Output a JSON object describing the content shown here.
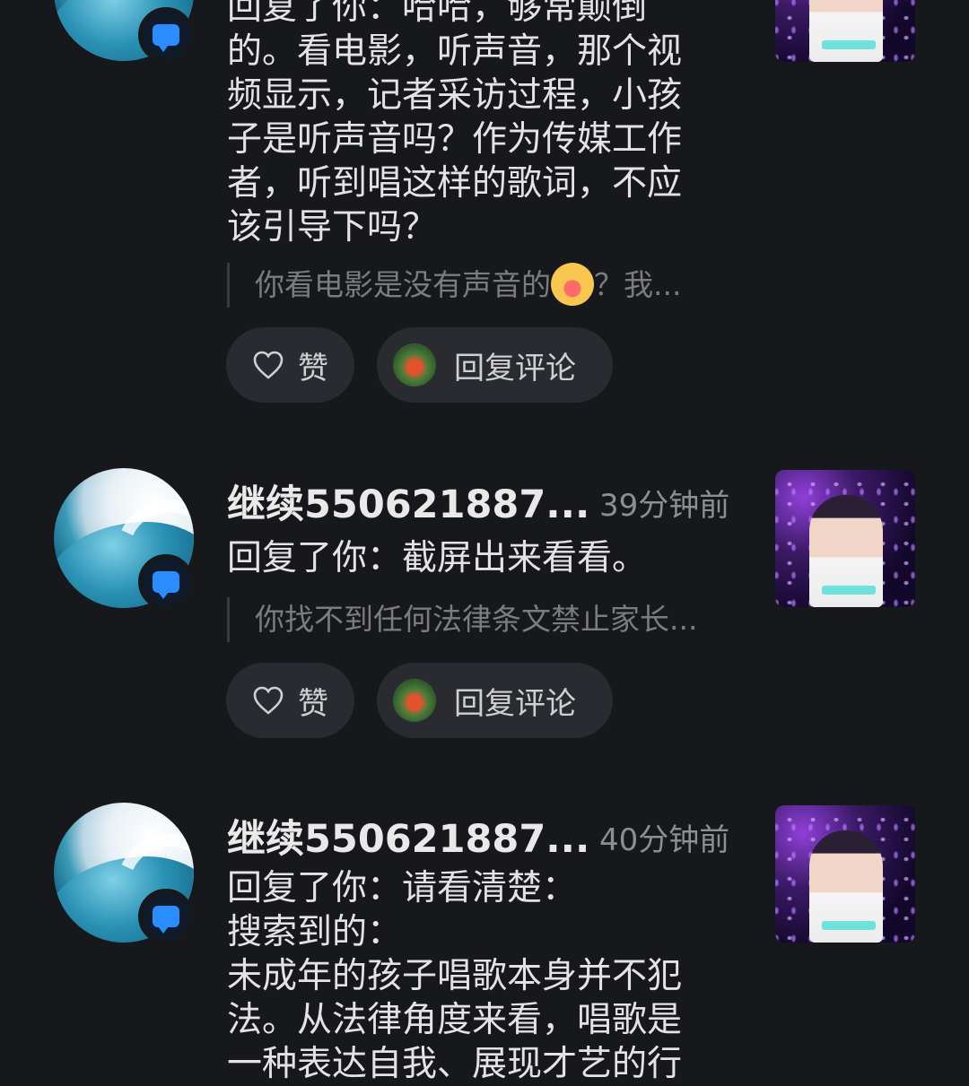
{
  "colors": {
    "background": "#17181c",
    "accent_blue": "#2b8cff",
    "pill_bg": "#2a2b30",
    "muted_text": "#8d8e94"
  },
  "notifications": [
    {
      "username": "",
      "time": "",
      "body": "回复了你：哈哈，够常颠倒\n的。看电影，听声音，那个视\n频显示，记者采访过程，小孩\n子是听声音吗？作为传媒工作\n者，听到唱这样的歌词，不应\n该引导下吗？",
      "quote_before_emoji": "你看电影是没有声音的",
      "quote_after_emoji": "？我...",
      "emoji_icon": "rolling-laughing-emoji",
      "like_label": "赞",
      "reply_label": "回复评论"
    },
    {
      "username": "继续550621887...",
      "time": "39分钟前",
      "body": "回复了你：截屏出来看看。",
      "quote": "你找不到任何法律条文禁止家长...",
      "like_label": "赞",
      "reply_label": "回复评论"
    },
    {
      "username": "继续550621887...",
      "time": "40分钟前",
      "body": "回复了你：请看清楚：\n搜索到的：\n未成年的孩子唱歌本身并不犯\n法。从法律角度来看，唱歌是\n一种表达自我、展现才艺的行"
    }
  ]
}
